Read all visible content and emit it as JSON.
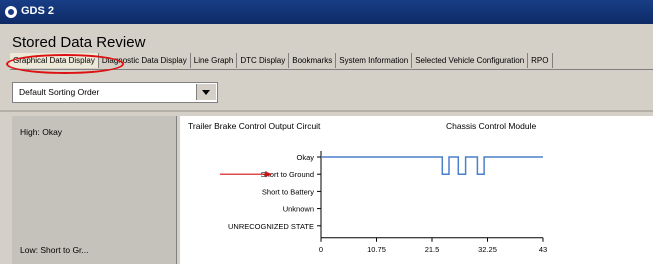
{
  "window": {
    "title": "GDS 2"
  },
  "page": {
    "title": "Stored Data Review"
  },
  "tabs": [
    {
      "label": "Graphical Data Display",
      "active": true
    },
    {
      "label": "Diagnostic Data Display",
      "active": false
    },
    {
      "label": "Line Graph",
      "active": false
    },
    {
      "label": "DTC Display",
      "active": false
    },
    {
      "label": "Bookmarks",
      "active": false
    },
    {
      "label": "System Information",
      "active": false
    },
    {
      "label": "Selected Vehicle Configuration",
      "active": false
    },
    {
      "label": "RPO",
      "active": false
    }
  ],
  "sorting": {
    "selected": "Default Sorting Order"
  },
  "left_panel": {
    "high": "High: Okay",
    "low": "Low: Short to Gr..."
  },
  "chart": {
    "title": "Trailer Brake Control Output Circuit",
    "module": "Chassis Control Module",
    "annotation": "red arrow pointing to Short to Ground"
  },
  "colors": {
    "title_bar": "#183d86",
    "signal_line": "#4a7fc9",
    "annotation": "#d11111"
  },
  "chart_data": {
    "type": "line",
    "title": "Trailer Brake Control Output Circuit",
    "subtitle": "Chassis Control Module",
    "xlabel": "",
    "ylabel": "",
    "xlim": [
      0,
      43
    ],
    "x_ticks": [
      "0",
      "10.75",
      "21.5",
      "32.25",
      "43"
    ],
    "categories": [
      "Okay",
      "Short to Ground",
      "Short to Battery",
      "Unknown",
      "UNRECOGNIZED STATE"
    ],
    "grid": false,
    "series": [
      {
        "x": [
          0,
          23.5,
          23.5,
          24.8,
          24.8,
          26.6,
          26.6,
          28.0,
          28.0,
          30.3,
          30.3,
          31.6,
          31.6,
          43
        ],
        "y": [
          "Okay",
          "Okay",
          "Short to Ground",
          "Short to Ground",
          "Okay",
          "Okay",
          "Short to Ground",
          "Short to Ground",
          "Okay",
          "Okay",
          "Short to Ground",
          "Short to Ground",
          "Okay",
          "Okay"
        ]
      }
    ]
  }
}
